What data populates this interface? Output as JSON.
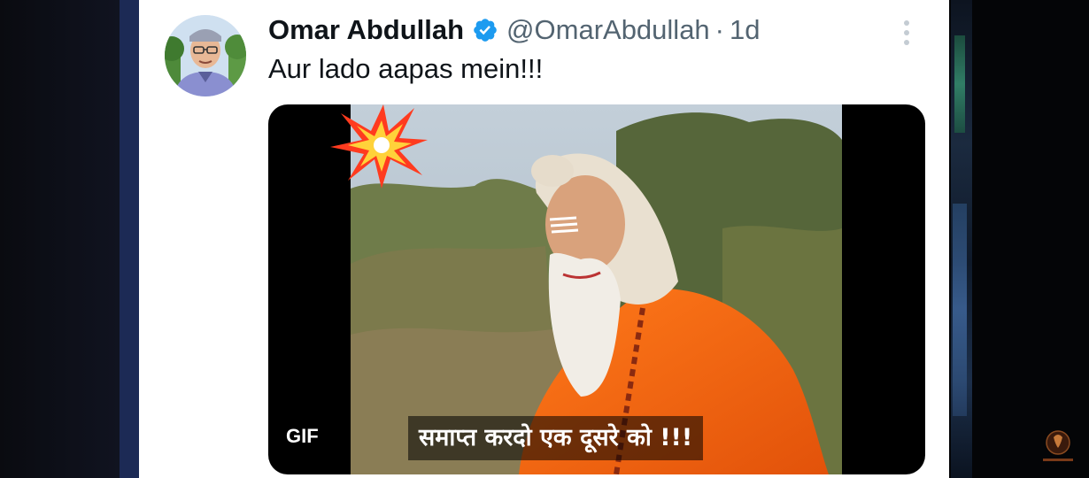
{
  "tweet": {
    "author_name": "Omar Abdullah",
    "handle": "@OmarAbdullah",
    "separator": "·",
    "time": "1d",
    "text": "Aur lado aapas mein!!!",
    "media": {
      "badge": "GIF",
      "caption": "समाप्त करदो एक दूसरे को !!!"
    }
  },
  "icons": {
    "verified": "verified-badge-icon",
    "more": "more-vertical-icon",
    "explosion": "collision-emoji-icon",
    "watermark": "channel-logo-icon"
  },
  "colors": {
    "name": "#0f1419",
    "secondary": "#536471",
    "verified": "#1d9bf0",
    "card_bg": "#ffffff"
  }
}
